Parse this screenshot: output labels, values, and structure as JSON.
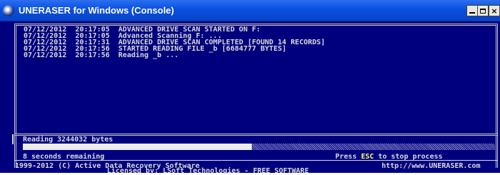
{
  "window": {
    "title": "UNERASER for Windows (Console)",
    "icon": "uneraser-app-icon",
    "controls": [
      "minimize-icon",
      "maximize-icon",
      "close-icon"
    ],
    "close_glyph": "×"
  },
  "log": {
    "lines": [
      "07/12/2012  20:17:05  ADVANCED DRIVE SCAN STARTED ON F:",
      "07/12/2012  20:17:05  Advanced Scanning F: ...",
      "07/12/2012  20:17:31  ADVANCED DRIVE SCAN COMPLETED [FOUND 14 RECORDS]",
      "07/12/2012  20:17:56  STARTED READING FILE _b [6684777 BYTES]",
      "07/12/2012  20:17:56  Reading _b ..."
    ]
  },
  "status": {
    "reading_text": "Reading 3244032 bytes",
    "progress_percent": 48.5,
    "remaining_text": "8 seconds remaining",
    "esc_prefix": "Press ",
    "esc_key": "ESC",
    "esc_suffix": " to stop process"
  },
  "footer": {
    "copyright": "1999-2012 (C) Active Data Recovery Software",
    "url": "http://www.UNERASER.com",
    "license": "Licensed by: LSoft Technologies - FREE SOFTWARE"
  },
  "colors": {
    "console_background": "#00007f",
    "console_text": "#d8d8d8",
    "esc_highlight": "#ffff55",
    "titlebar": "#0a4fe0"
  }
}
